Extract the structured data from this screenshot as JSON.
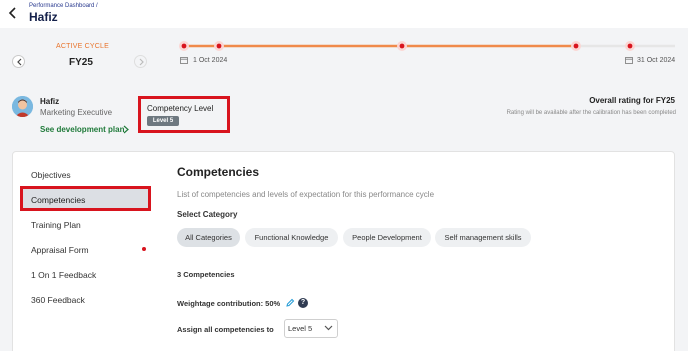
{
  "header": {
    "breadcrumb": "Performance Dashboard /",
    "title": "Hafiz"
  },
  "cycle": {
    "label": "ACTIVE CYCLE",
    "value": "FY25",
    "start_date": "1 Oct 2024",
    "end_date": "31 Oct 2024"
  },
  "user": {
    "name": "Hafiz",
    "role": "Marketing Executive",
    "dev_plan_label": "See development plan"
  },
  "competency_level": {
    "title": "Competency Level",
    "badge": "Level 5"
  },
  "overall": {
    "title": "Overall rating for FY25",
    "note": "Rating will be available after the calibration has been completed"
  },
  "sidebar": {
    "items": [
      {
        "label": "Objectives"
      },
      {
        "label": "Competencies"
      },
      {
        "label": "Training Plan"
      },
      {
        "label": "Appraisal Form"
      },
      {
        "label": "1 On 1 Feedback"
      },
      {
        "label": "360 Feedback"
      }
    ]
  },
  "main": {
    "title": "Competencies",
    "description": "List of competencies and levels of expectation for this performance cycle",
    "select_category_label": "Select Category",
    "categories": [
      {
        "label": "All Categories"
      },
      {
        "label": "Functional Knowledge"
      },
      {
        "label": "People Development"
      },
      {
        "label": "Self management skills"
      }
    ],
    "count_label": "3 Competencies",
    "weightage_label": "Weightage contribution: 50%",
    "assign_label": "Assign all competencies to",
    "assign_value": "Level 5"
  },
  "colors": {
    "accent_orange": "#e8742c",
    "highlight_red": "#d8141e",
    "link_green": "#1f7a3a"
  }
}
